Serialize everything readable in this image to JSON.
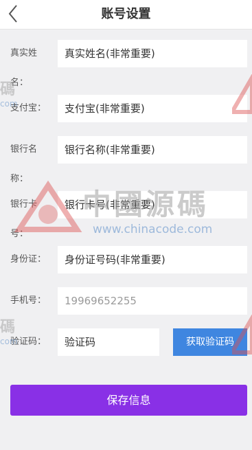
{
  "header": {
    "title": "账号设置"
  },
  "form": {
    "real_name": {
      "label": "真实姓名：",
      "placeholder": "真实姓名(非常重要)"
    },
    "alipay": {
      "label": "支付宝：",
      "placeholder": "支付宝(非常重要)"
    },
    "bank_name": {
      "label": "银行名称：",
      "placeholder": "银行名称(非常重要)"
    },
    "bank_card": {
      "label": "银行卡号：",
      "placeholder": "银行卡号(非常重要)"
    },
    "id_card": {
      "label": "身份证：",
      "placeholder": "身份证号码(非常重要)"
    },
    "phone": {
      "label": "手机号：",
      "placeholder": "19969652255"
    },
    "code": {
      "label": "验证码：",
      "placeholder": "验证码",
      "button": "获取验证码"
    }
  },
  "save_button": "保存信息",
  "watermark": {
    "text": "中國源碼",
    "url": "www.chinacode.com",
    "side_char": "碼",
    "side_url": "com"
  },
  "colors": {
    "accent": "#8930e6",
    "code_button": "#3f86e0",
    "background": "#f0f0f2"
  }
}
